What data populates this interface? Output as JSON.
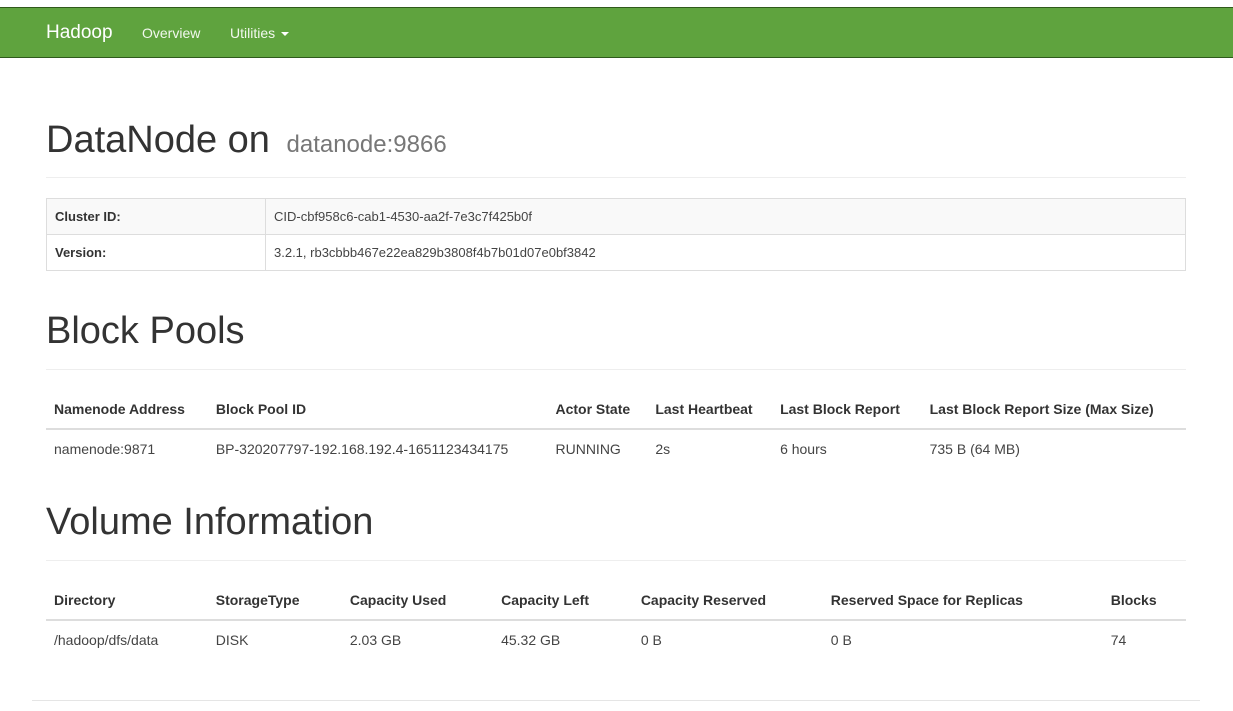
{
  "navbar": {
    "brand": "Hadoop",
    "overview": "Overview",
    "utilities": "Utilities"
  },
  "header": {
    "title": "DataNode on",
    "host": "datanode:9866"
  },
  "info": {
    "rows": [
      {
        "key": "Cluster ID:",
        "value": "CID-cbf958c6-cab1-4530-aa2f-7e3c7f425b0f"
      },
      {
        "key": "Version:",
        "value": "3.2.1, rb3cbbb467e22ea829b3808f4b7b01d07e0bf3842"
      }
    ]
  },
  "block_pools": {
    "title": "Block Pools",
    "columns": [
      "Namenode Address",
      "Block Pool ID",
      "Actor State",
      "Last Heartbeat",
      "Last Block Report",
      "Last Block Report Size (Max Size)"
    ],
    "rows": [
      [
        "namenode:9871",
        "BP-320207797-192.168.192.4-1651123434175",
        "RUNNING",
        "2s",
        "6 hours",
        "735 B (64 MB)"
      ]
    ]
  },
  "volumes": {
    "title": "Volume Information",
    "columns": [
      "Directory",
      "StorageType",
      "Capacity Used",
      "Capacity Left",
      "Capacity Reserved",
      "Reserved Space for Replicas",
      "Blocks"
    ],
    "rows": [
      [
        "/hadoop/dfs/data",
        "DISK",
        "2.03 GB",
        "45.32 GB",
        "0 B",
        "0 B",
        "74"
      ]
    ]
  },
  "colors": {
    "navbar": "#5fa33e"
  }
}
